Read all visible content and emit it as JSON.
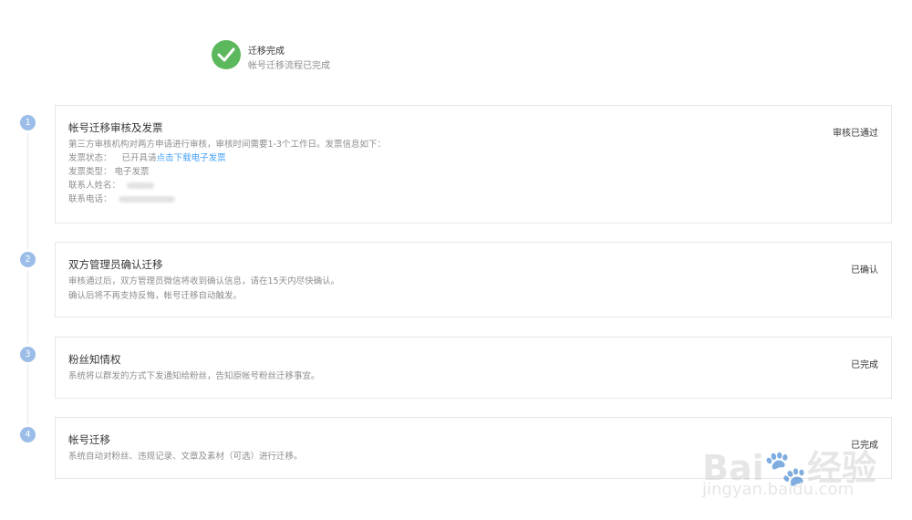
{
  "header": {
    "icon": "check-circle-icon",
    "title": "迁移完成",
    "subtitle": "帐号迁移流程已完成",
    "accent_color": "#5cb85c"
  },
  "steps": [
    {
      "number": "1",
      "title": "帐号迁移审核及发票",
      "status": "审核已通过",
      "description": "第三方审核机构对两方申请进行审核，审核时间需要1-3个工作日。发票信息如下：",
      "invoice_status_label": "发票状态：",
      "invoice_status_value": "已开具请",
      "invoice_link": "点击下载电子发票",
      "invoice_type_label": "发票类型：",
      "invoice_type_value": "电子发票",
      "contact_name_label": "联系人姓名：",
      "contact_phone_label": "联系电话："
    },
    {
      "number": "2",
      "title": "双方管理员确认迁移",
      "status": "已确认",
      "lines": [
        "审核通过后，双方管理员微信将收到确认信息，请在15天内尽快确认。",
        "确认后将不再支持反悔，帐号迁移自动触发。"
      ]
    },
    {
      "number": "3",
      "title": "粉丝知情权",
      "status": "已完成",
      "lines": [
        "系统将以群发的方式下发通知给粉丝，告知原帐号粉丝迁移事宜。"
      ]
    },
    {
      "number": "4",
      "title": "帐号迁移",
      "status": "已完成",
      "lines": [
        "系统自动对粉丝、违规记录、文章及素材（可选）进行迁移。"
      ]
    }
  ],
  "watermark": {
    "logo": "Bai🐾经验",
    "url": "jingyan.baidu.com"
  }
}
